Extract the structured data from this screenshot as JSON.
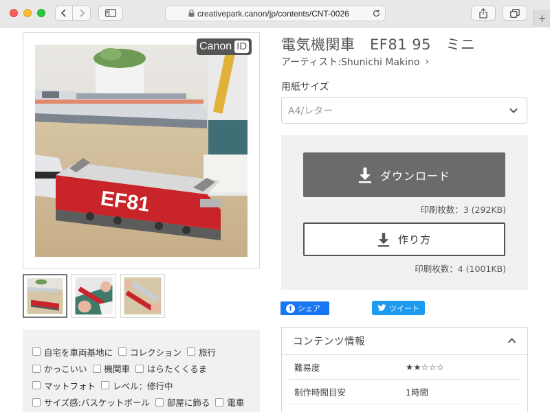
{
  "browser": {
    "url": "creativepark.canon/jp/contents/CNT-0026",
    "new_tab_symbol": "+"
  },
  "badge": {
    "brand": "Canon",
    "id_label": "ID"
  },
  "product": {
    "title": "電気機関車　EF81 95　ミニ",
    "artist": "アーティスト:Shunichi Makino",
    "artist_chevron": "›"
  },
  "paper": {
    "label": "用紙サイズ",
    "selected": "A4/レター"
  },
  "download": {
    "button_label": "ダウンロード",
    "info": "印刷枚数：3 (292KB)"
  },
  "howto": {
    "button_label": "作り方",
    "info": "印刷枚数：4 (1001KB)"
  },
  "social": {
    "facebook_label": "シェア",
    "twitter_label": "ツイート"
  },
  "contents": {
    "header": "コンテンツ情報",
    "rows": [
      {
        "label": "難易度",
        "value": "★★☆☆☆"
      },
      {
        "label": "制作時間目安",
        "value": "1時間"
      }
    ]
  },
  "tags": {
    "row1": [
      "自宅を車両基地に",
      "コレクション",
      "旅行"
    ],
    "row2": [
      "かっこいい",
      "機関車",
      "はらたくくるま"
    ],
    "row3": [
      "マットフォト",
      "レベル：修行中"
    ],
    "row4": [
      "サイズ感:バスケットボール",
      "部屋に飾る",
      "電車"
    ]
  },
  "colors": {
    "download_button": "#6b6b6b",
    "facebook": "#1877f2",
    "twitter": "#1d9bf0",
    "panel_bg": "#f1f1f1"
  },
  "icons": {
    "back": "chevron-left-icon",
    "forward": "chevron-right-icon",
    "sidebar": "sidebar-icon",
    "lock": "lock-icon",
    "reload": "reload-icon",
    "share": "share-icon",
    "tabs": "tabs-icon",
    "download": "download-icon",
    "dropdown": "chevron-down-icon",
    "collapse": "chevron-up-icon"
  }
}
